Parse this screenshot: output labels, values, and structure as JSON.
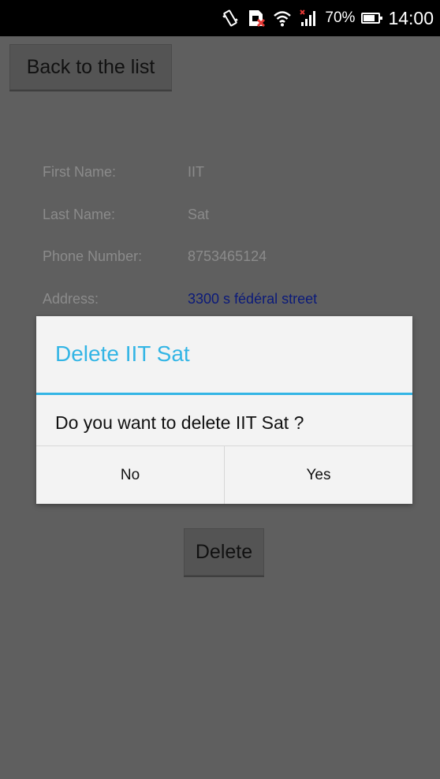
{
  "status_bar": {
    "icons": [
      "vibrate-icon",
      "sim-card-error-icon",
      "wifi-icon",
      "signal-icon"
    ],
    "battery_percent": "70%",
    "time": "14:00"
  },
  "screen": {
    "back_button": "Back to the list",
    "fields": [
      {
        "label": "First Name:",
        "value": "IIT"
      },
      {
        "label": "Last Name:",
        "value": "Sat"
      },
      {
        "label": "Phone Number:",
        "value": "8753465124"
      },
      {
        "label": "Address:",
        "value": "3300 s fédéral street"
      }
    ],
    "delete_button": "Delete"
  },
  "dialog": {
    "title": "Delete IIT Sat",
    "message": "Do you want to delete IIT Sat ?",
    "no_button": "No",
    "yes_button": "Yes"
  },
  "colors": {
    "dialog_accent": "#33b5e5",
    "address_link": "#0b1a7a",
    "dim_background": "#5f5f5f"
  }
}
